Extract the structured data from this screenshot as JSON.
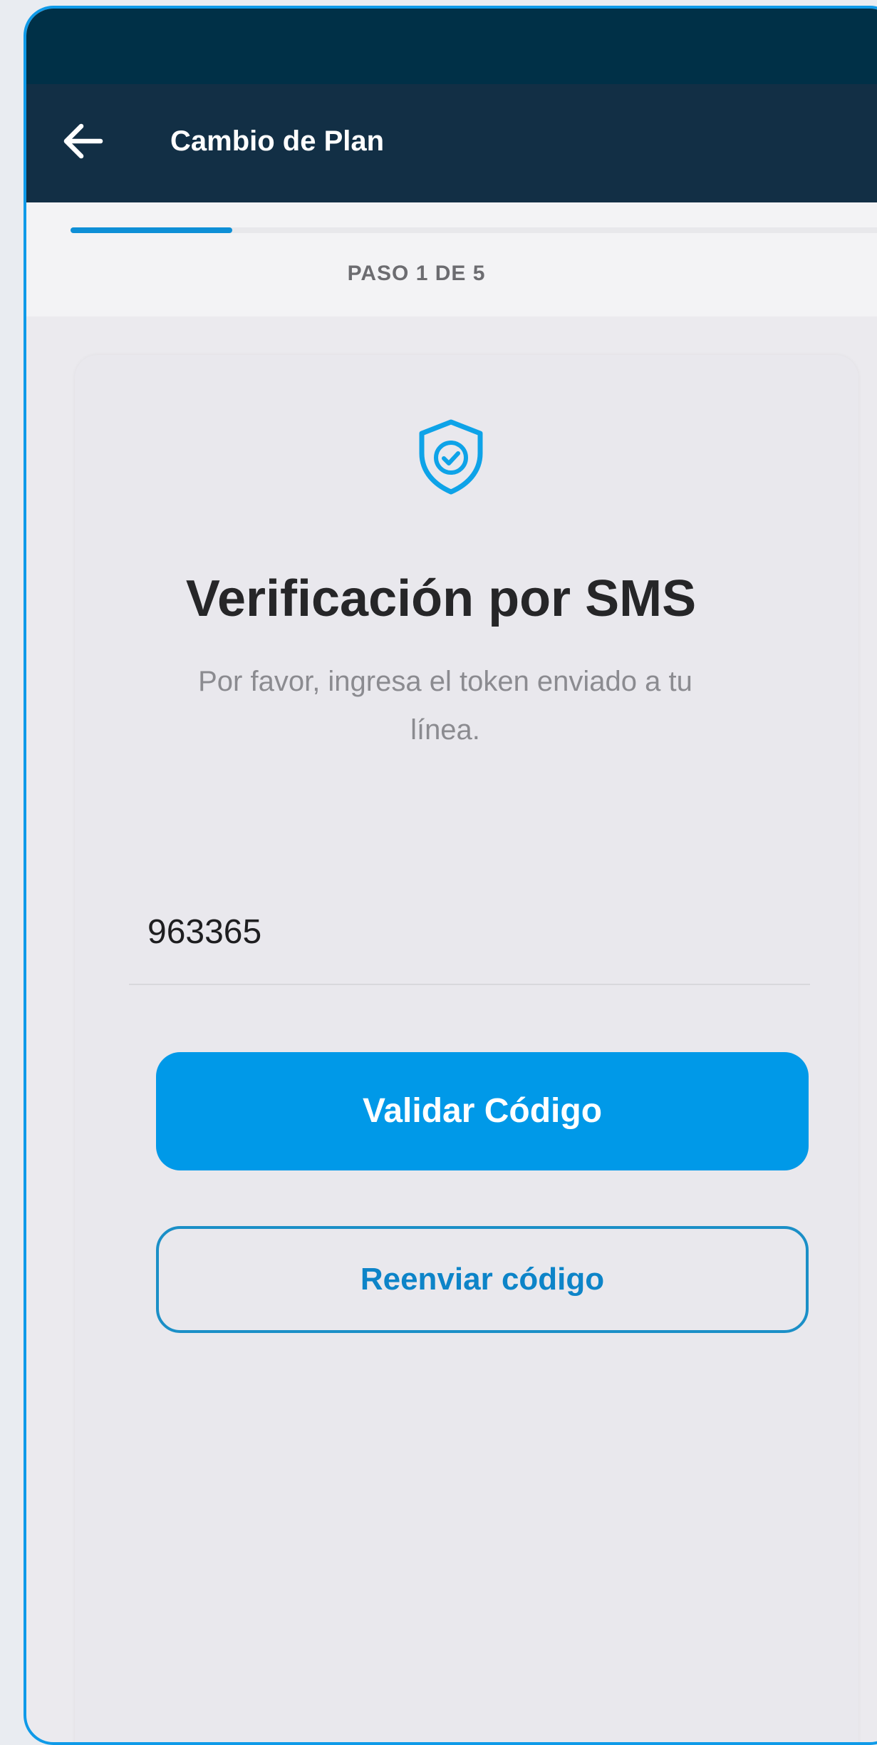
{
  "app_bar": {
    "back_icon": "arrow-left-icon",
    "title": "Cambio de Plan"
  },
  "progress": {
    "current_step": 1,
    "total_steps": 5,
    "fraction": 0.2,
    "label": "PASO 1 DE 5"
  },
  "verification": {
    "icon": "shield-check-icon",
    "title": "Verificación por SMS",
    "subtitle": "Por favor, ingresa el token enviado a tu línea.",
    "token_value": "963365",
    "validate_label": "Validar Código",
    "resend_label": "Reenviar código"
  },
  "colors": {
    "frame_border": "#0f9ae8",
    "status_bar": "#003047",
    "app_bar": "#122f45",
    "accent": "#0099e8",
    "background": "#ebeaee"
  }
}
